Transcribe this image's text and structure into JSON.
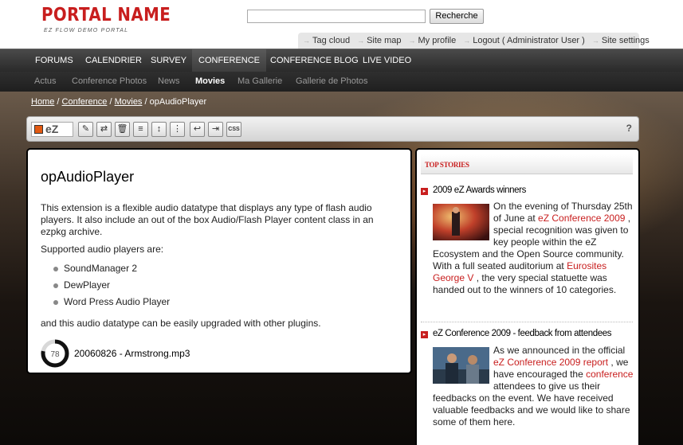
{
  "header": {
    "portal_name": "PORTAL NAME",
    "portal_subtitle": "EZ FLOW DEMO PORTAL",
    "search_placeholder": "",
    "search_button": "Recherche",
    "user_links": [
      "Tag cloud",
      "Site map",
      "My profile",
      "Logout ( Administrator User )",
      "Site settings"
    ]
  },
  "topnav": {
    "items": [
      "FORUMS",
      "CALENDRIER",
      "SURVEY",
      "CONFERENCE",
      "CONFERENCE BLOG",
      "LIVE VIDEO"
    ],
    "active": "CONFERENCE"
  },
  "subnav": {
    "items": [
      "Actus",
      "Conference Photos",
      "News",
      "Movies",
      "Ma Gallerie",
      "Gallerie de Photos"
    ],
    "active": "Movies"
  },
  "breadcrumb": {
    "links": [
      "Home",
      "Conference",
      "Movies"
    ],
    "current": "opAudioPlayer"
  },
  "toolbar": {
    "logo_text": "eZ",
    "css_label": "CSS",
    "help": "?"
  },
  "main": {
    "title": "opAudioPlayer",
    "description": "This extension is a flexible audio datatype that displays any type of flash audio players. It also include an out of the box Audio/Flash Player content class in an ezpkg archive.",
    "supported_label": "Supported audio players are:",
    "players": [
      "SoundManager 2",
      "DewPlayer",
      "Word Press Audio Player"
    ],
    "upgrade_text": "and this audio datatype can be easily upgraded with other plugins.",
    "player_progress_label": "78",
    "player_progress": 0.78,
    "track": "20060826 - Armstrong.mp3"
  },
  "side": {
    "header": "TOP STORIES",
    "stories": [
      {
        "title": "2009 eZ Awards winners",
        "text_parts": [
          {
            "t": "On the evening of Thursday 25th of June at ",
            "red": false
          },
          {
            "t": "eZ Conference 2009",
            "red": true
          },
          {
            "t": " , special recognition was given to key people within the eZ Ecosystem and the Open Source community. With a full seated auditorium at ",
            "red": false
          },
          {
            "t": "Eurosites George V",
            "red": true
          },
          {
            "t": " , the very special statuette was handed out to the winners of 10 categories.",
            "red": false
          }
        ]
      },
      {
        "title": "eZ Conference 2009 - feedback from attendees",
        "text_parts": [
          {
            "t": "As we announced in the official ",
            "red": false
          },
          {
            "t": "eZ Conference 2009 report",
            "red": true
          },
          {
            "t": " , we have encouraged the ",
            "red": false
          },
          {
            "t": "conference",
            "red": true
          },
          {
            "t": " attendees to give us their feedbacks on the event. We have received valuable feedbacks and we would like to share some of them here.",
            "red": false
          }
        ]
      }
    ]
  },
  "colors": {
    "brand_red": "#c81e1e",
    "nav_dark": "#2a2a2a",
    "accent_orange": "#e35a12"
  }
}
